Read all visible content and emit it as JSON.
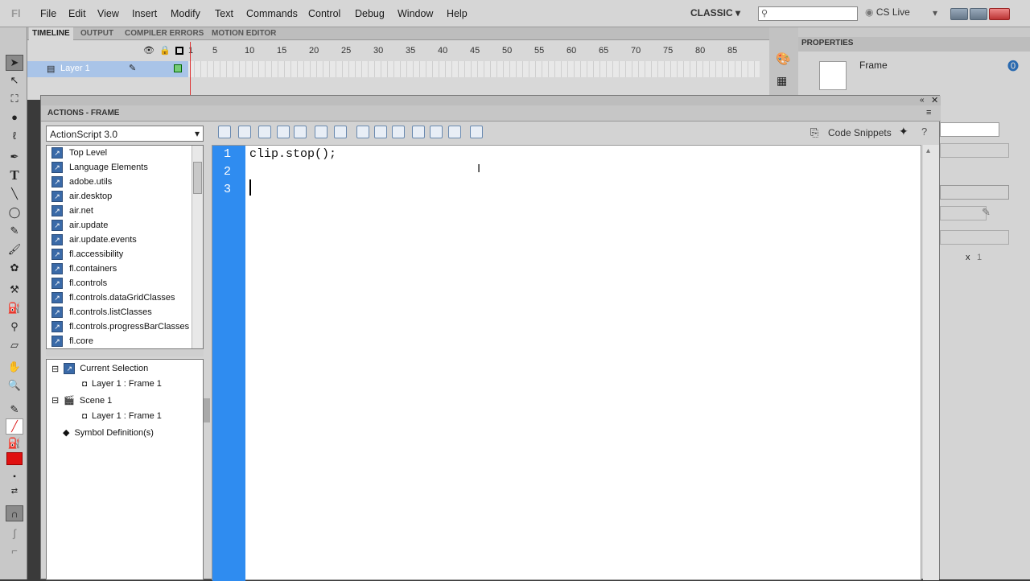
{
  "menubar": {
    "logo": "Fl",
    "items": [
      "File",
      "Edit",
      "View",
      "Insert",
      "Modify",
      "Text",
      "Commands",
      "Control",
      "Debug",
      "Window",
      "Help"
    ],
    "workspace": "CLASSIC",
    "cslive": "CS Live"
  },
  "timeline": {
    "tabs": [
      "TIMELINE",
      "OUTPUT",
      "COMPILER ERRORS",
      "MOTION EDITOR"
    ],
    "layer": "Layer 1",
    "frame_numbers": [
      "1",
      "5",
      "10",
      "15",
      "20",
      "25",
      "30",
      "35",
      "40",
      "45",
      "50",
      "55",
      "60",
      "65",
      "70",
      "75",
      "80",
      "85"
    ]
  },
  "properties": {
    "tab": "PROPERTIES",
    "frame_label": "Frame",
    "x_label": "x",
    "x_value": "1"
  },
  "actions": {
    "title": "ACTIONS - FRAME",
    "as_version": "ActionScript 3.0",
    "code_snippets": "Code Snippets",
    "library": [
      "Top Level",
      "Language Elements",
      "adobe.utils",
      "air.desktop",
      "air.net",
      "air.update",
      "air.update.events",
      "fl.accessibility",
      "fl.containers",
      "fl.controls",
      "fl.controls.dataGridClasses",
      "fl.controls.listClasses",
      "fl.controls.progressBarClasses",
      "fl.core"
    ],
    "tree": {
      "current_selection": "Current Selection",
      "current_frame": "Layer 1 : Frame 1",
      "scene": "Scene 1",
      "scene_frame": "Layer 1 : Frame 1",
      "symbols": "Symbol Definition(s)"
    },
    "code_lines": [
      {
        "n": "1",
        "text": "clip.stop();"
      },
      {
        "n": "2",
        "text": ""
      },
      {
        "n": "3",
        "text": ""
      }
    ]
  },
  "colors": {
    "gutter": "#2f8cf0",
    "layer_highlight": "#a9c4e8",
    "fill_color": "#e01010"
  }
}
